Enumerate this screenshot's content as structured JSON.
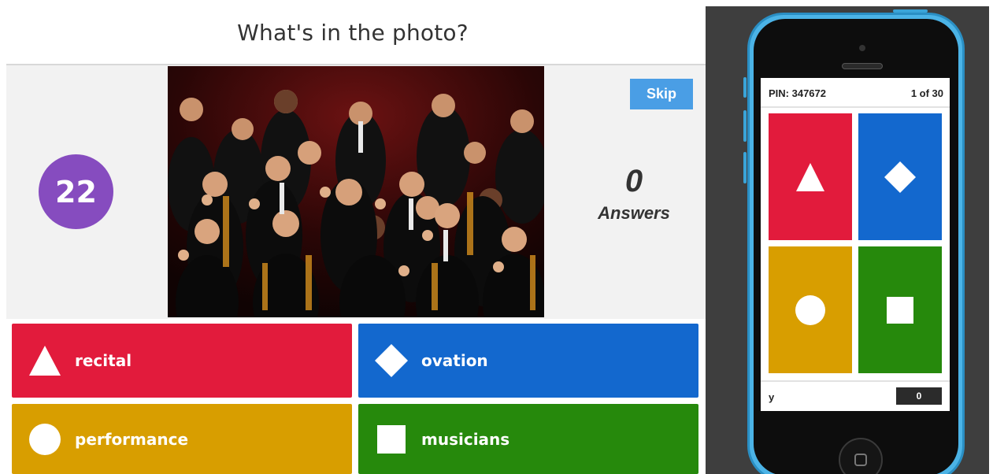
{
  "question": {
    "title": "What's in the photo?"
  },
  "timer": {
    "value": "22"
  },
  "skip": {
    "label": "Skip"
  },
  "answers_summary": {
    "count": "0",
    "label": "Answers"
  },
  "answers": [
    {
      "label": "recital",
      "shape": "triangle-icon"
    },
    {
      "label": "ovation",
      "shape": "diamond-icon"
    },
    {
      "label": "performance",
      "shape": "circle-icon"
    },
    {
      "label": "musicians",
      "shape": "square-icon"
    }
  ],
  "phone": {
    "pin": "PIN: 347672",
    "progress": "1 of 30",
    "nickname": "y",
    "score": "0"
  },
  "colors": {
    "red": "#e21b3c",
    "blue": "#1368ce",
    "yellow": "#d89e00",
    "green": "#26890c",
    "purple": "#864cbf",
    "skip": "#4a9ee5"
  }
}
